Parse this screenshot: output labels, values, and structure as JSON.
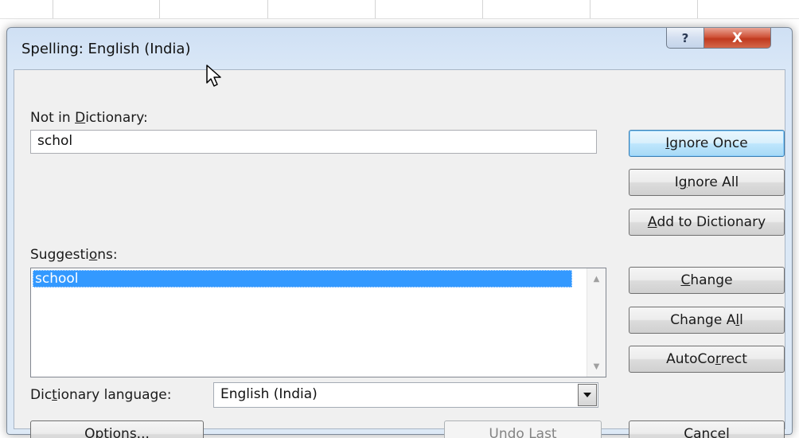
{
  "dialog": {
    "title": "Spelling: English (India)",
    "help_glyph": "?",
    "close_glyph": "X"
  },
  "not_in_dictionary": {
    "label_pre": "Not in ",
    "label_key": "D",
    "label_post": "ictionary:",
    "value": "schol"
  },
  "suggestions": {
    "label_pre": "Suggesti",
    "label_key": "o",
    "label_post": "ns:",
    "items": [
      "school"
    ],
    "selected_index": 0
  },
  "language": {
    "label_pre": "Dic",
    "label_key": "t",
    "label_post": "ionary language:",
    "value": "English (India)"
  },
  "buttons": {
    "ignore_once": {
      "pre": "",
      "key": "I",
      "post": "gnore Once"
    },
    "ignore_all": {
      "pre": "I",
      "key": "g",
      "post": "nore All"
    },
    "add_to_dictionary": {
      "pre": "",
      "key": "A",
      "post": "dd to Dictionary"
    },
    "change": {
      "pre": "",
      "key": "C",
      "post": "hange"
    },
    "change_all": {
      "pre": "Change A",
      "key": "l",
      "post": "l"
    },
    "autocorrect": {
      "pre": "AutoCo",
      "key": "r",
      "post": "rect"
    },
    "options": {
      "pre": "",
      "key": "O",
      "post": "ptions..."
    },
    "undo_last": {
      "pre": "Undo Last",
      "key": "",
      "post": ""
    },
    "cancel": {
      "pre": "Cancel",
      "key": "",
      "post": ""
    }
  },
  "icons": {
    "help": "help-icon",
    "close": "close-icon",
    "cursor": "mouse-pointer-icon",
    "dropdown": "chevron-down-icon",
    "scroll_up": "scroll-up-icon",
    "scroll_down": "scroll-down-icon"
  },
  "colors": {
    "selection": "#3399ff",
    "close_button": "#c84a2e",
    "default_button_border": "#3c7fb1"
  }
}
